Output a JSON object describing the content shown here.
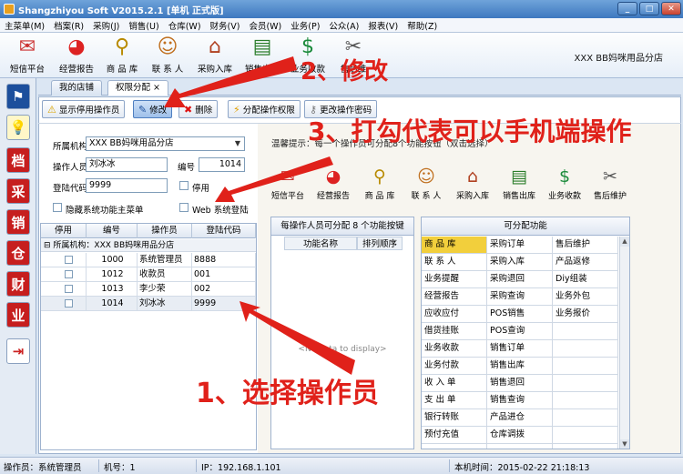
{
  "window": {
    "title": "Shangzhiyou Soft V2015.2.1 [单机 正式版]"
  },
  "menu": [
    "主菜单(M)",
    "档案(R)",
    "采购(J)",
    "销售(U)",
    "仓库(W)",
    "财务(V)",
    "会员(W)",
    "业务(P)",
    "公众(A)",
    "报表(V)",
    "帮助(Z)"
  ],
  "toolbar": [
    "短信平台",
    "经营报告",
    "商 品 库",
    "联 系 人",
    "采购入库",
    "销售出库",
    "业务收款",
    "售后维"
  ],
  "company": "XXX BB妈咪用品分店",
  "tabs": {
    "my_store": "我的店铺",
    "perm": "权限分配",
    "close": "×"
  },
  "actions": {
    "show_disabled": "显示停用操作员",
    "edit": "修改",
    "delete": "删除",
    "assign": "分配操作权限",
    "change_pwd": "更改操作密码"
  },
  "form": {
    "org_label": "所属机构",
    "org_value": "XXX BB妈咪用品分店",
    "operator_label": "操作人员",
    "operator_value": "刘冰冰",
    "code_label": "编号",
    "code_value": "1014",
    "login_label": "登陆代码",
    "login_value": "9999",
    "disable_label": "停用",
    "hide_label": "隐藏系统功能主菜单",
    "web_label": "Web 系统登陆"
  },
  "grid": {
    "headers": [
      "停用",
      "编号",
      "操作员",
      "登陆代码"
    ],
    "group": "所属机构：XXX BB妈咪用品分店",
    "rows": [
      {
        "code": "1000",
        "name": "系统管理员",
        "login": "8888"
      },
      {
        "code": "1012",
        "name": "收款员",
        "login": "001"
      },
      {
        "code": "1013",
        "name": "李少荣",
        "login": "002"
      },
      {
        "code": "1014",
        "name": "刘冰冰",
        "login": "9999"
      }
    ]
  },
  "tip": "温馨提示：每一个操作员可分配8个功能按钮（双击选择）",
  "right_tools": [
    "短信平台",
    "经营报告",
    "商 品 库",
    "联 系 人",
    "采购入库",
    "销售出库",
    "业务收款",
    "售后维护"
  ],
  "assigned": {
    "title": "每操作人员可分配 8 个功能按键",
    "col_name": "功能名称",
    "col_order": "排列顺序",
    "empty": "<No data to display>"
  },
  "functions": {
    "title": "可分配功能",
    "rows": [
      [
        "商 品 库",
        "采购订单",
        "售后维护"
      ],
      [
        "联 系 人",
        "采购入库",
        "产品返修"
      ],
      [
        "业务提醒",
        "采购退回",
        "Diy组装"
      ],
      [
        "经营报告",
        "采购查询",
        "业务外包"
      ],
      [
        "应收应付",
        "POS销售",
        "业务报价"
      ],
      [
        "借货挂账",
        "POS查询",
        ""
      ],
      [
        "业务收款",
        "销售订单",
        ""
      ],
      [
        "业务付款",
        "销售出库",
        ""
      ],
      [
        "收 入 单",
        "销售退回",
        ""
      ],
      [
        "支 出 单",
        "销售查询",
        ""
      ],
      [
        "银行转账",
        "产品进仓",
        ""
      ],
      [
        "预付充值",
        "仓库调拨",
        ""
      ],
      [
        "",
        "",
        ""
      ]
    ]
  },
  "status": {
    "operator": "操作员：系统管理员",
    "machine": "机号：1",
    "ip": "IP：192.168.1.101",
    "time": "本机时间：2015-02-22 21:18:13"
  },
  "annotations": {
    "step1": "1、选择操作员",
    "step2": "2、修改",
    "step3": "3、打勾代表可以手机端操作"
  },
  "colors": {
    "annotation": "#e0211a",
    "highlight": "#f2cf3c",
    "titlebar": "#3d78bf"
  }
}
